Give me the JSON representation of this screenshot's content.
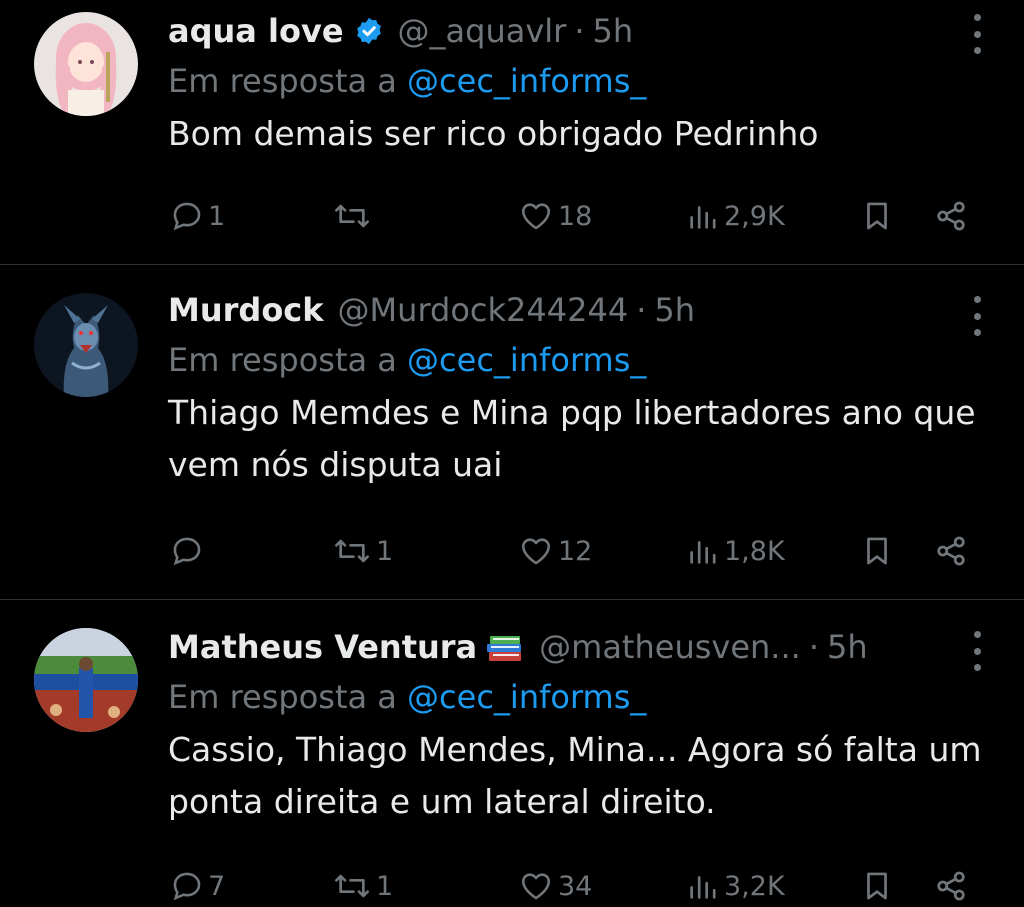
{
  "tweets": [
    {
      "name": "aqua love",
      "verified": true,
      "handle": "@_aquavlr",
      "time": "5h",
      "reply_prefix": "Em resposta a",
      "reply_to": "@cec_informs_",
      "text": "Bom demais ser rico obrigado Pedrinho",
      "replies": "1",
      "retweets": "",
      "likes": "18",
      "views": "2,9K"
    },
    {
      "name": "Murdock",
      "verified": false,
      "handle": "@Murdock244244",
      "time": "5h",
      "reply_prefix": "Em resposta a",
      "reply_to": "@cec_informs_",
      "text": "Thiago Memdes e Mina pqp libertadores ano que vem nós disputa uai",
      "replies": "",
      "retweets": "1",
      "likes": "12",
      "views": "1,8K"
    },
    {
      "name": "Matheus Ventura",
      "verified": false,
      "emoji": "books-emoji",
      "handle": "@matheusven...",
      "time": "5h",
      "reply_prefix": "Em resposta a",
      "reply_to": "@cec_informs_",
      "text": "Cassio, Thiago Mendes, Mina... Agora só falta um ponta direita e um lateral direito.",
      "replies": "7",
      "retweets": "1",
      "likes": "34",
      "views": "3,2K"
    }
  ],
  "colors": {
    "background": "#000000",
    "text": "#e7e9ea",
    "muted": "#71767b",
    "accent": "#1d9bf0",
    "divider": "#2f3336"
  },
  "icons": [
    "verified-badge-icon",
    "more-icon",
    "reply-icon",
    "retweet-icon",
    "like-icon",
    "views-icon",
    "bookmark-icon",
    "share-icon"
  ]
}
